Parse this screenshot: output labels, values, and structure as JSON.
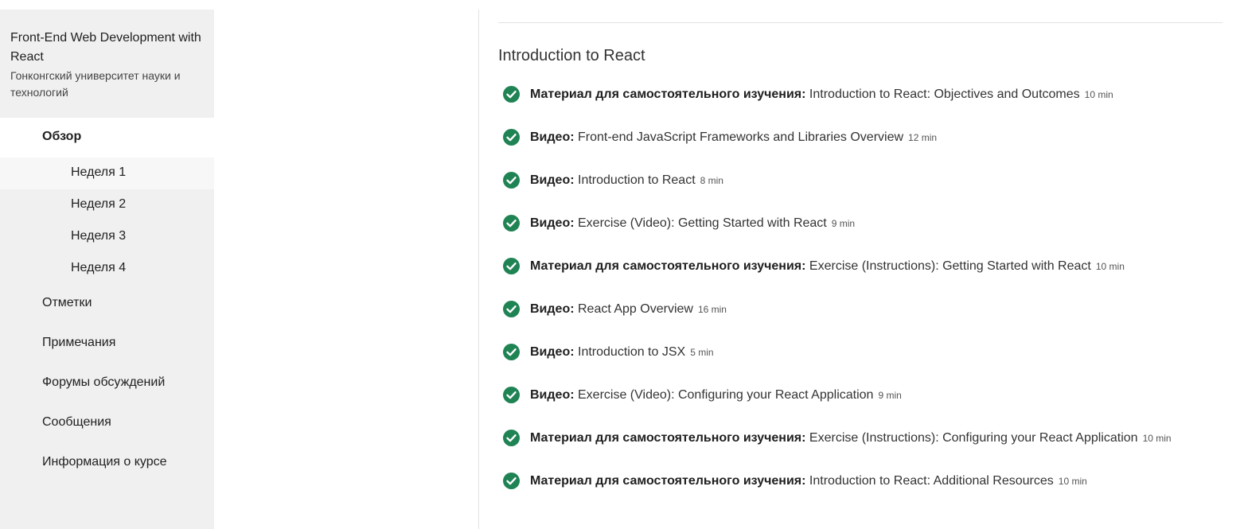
{
  "sidebar": {
    "course_title": "Front-End Web Development with React",
    "course_org": "Гонконгский университет науки и технологий",
    "overview_label": "Обзор",
    "weeks": [
      "Неделя 1",
      "Неделя 2",
      "Неделя 3",
      "Неделя 4"
    ],
    "nav_items": [
      "Отметки",
      "Примечания",
      "Форумы обсуждений",
      "Сообщения",
      "Информация о курсе"
    ]
  },
  "main": {
    "module_title": "Introduction to React",
    "items": [
      {
        "type": "Материал для самостоятельного изучения:",
        "title": "Introduction to React: Objectives and Outcomes",
        "duration": "10 min"
      },
      {
        "type": "Видео:",
        "title": "Front-end JavaScript Frameworks and Libraries Overview",
        "duration": "12 min"
      },
      {
        "type": "Видео:",
        "title": "Introduction to React",
        "duration": "8 min"
      },
      {
        "type": "Видео:",
        "title": "Exercise (Video): Getting Started with React",
        "duration": "9 min"
      },
      {
        "type": "Материал для самостоятельного изучения:",
        "title": "Exercise (Instructions): Getting Started with React",
        "duration": "10 min"
      },
      {
        "type": "Видео:",
        "title": "React App Overview",
        "duration": "16 min"
      },
      {
        "type": "Видео:",
        "title": "Introduction to JSX",
        "duration": "5 min"
      },
      {
        "type": "Видео:",
        "title": "Exercise (Video): Configuring your React Application",
        "duration": "9 min"
      },
      {
        "type": "Материал для самостоятельного изучения:",
        "title": "Exercise (Instructions): Configuring your React Application",
        "duration": "10 min"
      },
      {
        "type": "Материал для самостоятельного изучения:",
        "title": "Introduction to React: Additional Resources",
        "duration": "10 min"
      }
    ]
  },
  "colors": {
    "check": "#1f8354",
    "sidebar_bg": "#f0f0f0"
  },
  "icons": {
    "completed": "check-circle-icon"
  }
}
